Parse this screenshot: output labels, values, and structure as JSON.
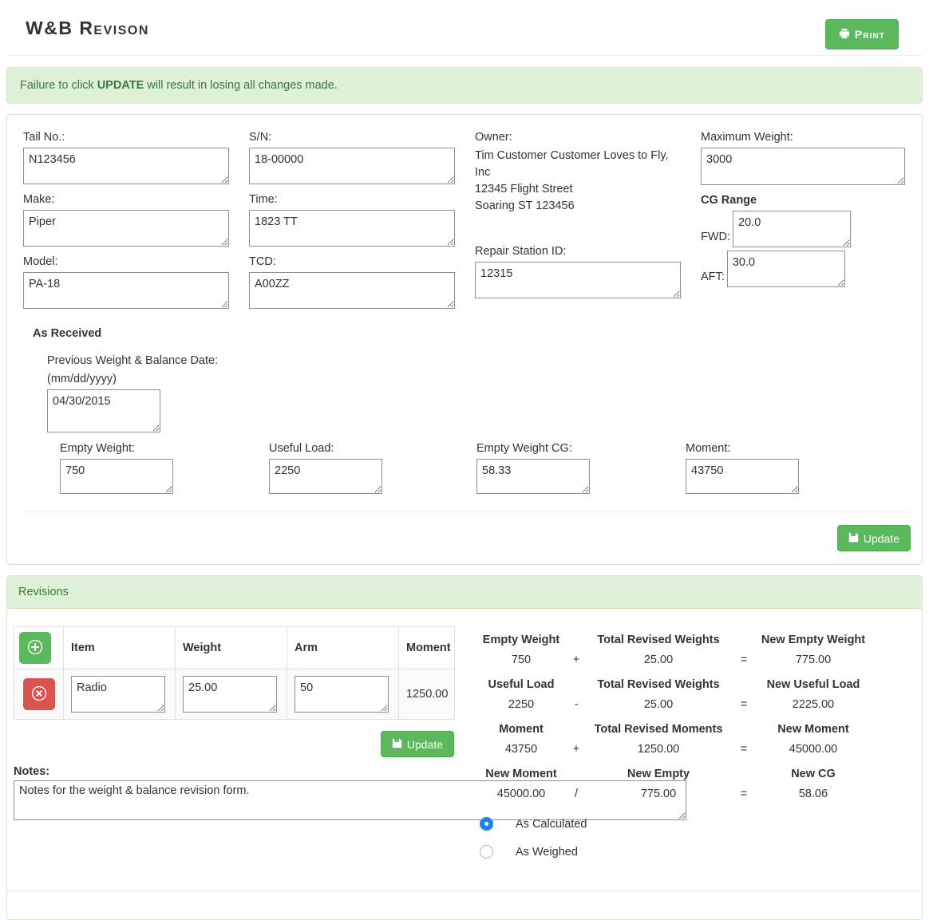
{
  "header": {
    "title": "W&B Revison",
    "print_label": "Print",
    "print_icon": "printer-icon"
  },
  "alert": {
    "prefix": "Failure to click ",
    "emphasis": "UPDATE",
    "suffix": " will result in losing all changes made."
  },
  "form": {
    "tail_no": {
      "label": "Tail No.:",
      "value": "N123456"
    },
    "make": {
      "label": "Make:",
      "value": "Piper"
    },
    "model": {
      "label": "Model:",
      "value": "PA-18"
    },
    "sn": {
      "label": "S/N:",
      "value": "18-00000"
    },
    "time": {
      "label": "Time:",
      "value": "1823 TT"
    },
    "tcd": {
      "label": "TCD:",
      "value": "A00ZZ"
    },
    "owner": {
      "label": "Owner:",
      "lines": "Tim Customer Customer Loves to Fly, Inc\n12345 Flight Street\nSoaring ST 123456"
    },
    "repair_station": {
      "label": "Repair Station ID:",
      "value": "12315"
    },
    "maximum_weight": {
      "label": "Maximum Weight:",
      "value": "3000"
    },
    "cg_range": {
      "title": "CG Range",
      "fwd": {
        "label": "FWD:",
        "value": "20.0"
      },
      "aft": {
        "label": "AFT:",
        "value": "30.0"
      }
    }
  },
  "as_received": {
    "title": "As Received",
    "prev_date": {
      "label_line1": "Previous Weight & Balance Date:",
      "label_line2": "(mm/dd/yyyy)",
      "value": "04/30/2015"
    },
    "empty_weight": {
      "label": "Empty Weight:",
      "value": "750"
    },
    "useful_load": {
      "label": "Useful Load:",
      "value": "2250"
    },
    "empty_weight_cg": {
      "label": "Empty Weight CG:",
      "value": "58.33"
    },
    "moment": {
      "label": "Moment:",
      "value": "43750"
    },
    "update_label": "Update",
    "update_icon": "save-icon"
  },
  "revisions": {
    "panel_title": "Revisions",
    "add_icon": "plus-circle-icon",
    "delete_icon": "times-circle-icon",
    "columns": [
      "Item",
      "Weight",
      "Arm",
      "Moment"
    ],
    "rows": [
      {
        "item": "Radio",
        "weight": "25.00",
        "arm": "50",
        "moment": "1250.00"
      }
    ],
    "update_label": "Update",
    "update_icon": "save-icon",
    "notes": {
      "label": "Notes:",
      "value": "Notes for the weight & balance revision form."
    },
    "options": [
      {
        "label": "As Calculated",
        "selected": true
      },
      {
        "label": "As Weighed",
        "selected": false
      }
    ],
    "calc": {
      "r1": {
        "h1": "Empty Weight",
        "h2": "Total Revised Weights",
        "h3": "New Empty Weight",
        "v1": "750",
        "op1": "+",
        "v2": "25.00",
        "op2": "=",
        "v3": "775.00"
      },
      "r2": {
        "h1": "Useful Load",
        "h2": "Total Revised Weights",
        "h3": "New Useful Load",
        "v1": "2250",
        "op1": "-",
        "v2": "25.00",
        "op2": "=",
        "v3": "2225.00"
      },
      "r3": {
        "h1": "Moment",
        "h2": "Total Revised Moments",
        "h3": "New Moment",
        "v1": "43750",
        "op1": "+",
        "v2": "1250.00",
        "op2": "=",
        "v3": "45000.00"
      },
      "r4": {
        "h1": "New Moment",
        "h2": "New Empty",
        "h3": "New CG",
        "v1": "45000.00",
        "op1": "/",
        "v2": "775.00",
        "op2": "=",
        "v3": "58.06"
      }
    }
  },
  "colors": {
    "green": "#5cb85c",
    "red": "#d9534f",
    "alert_bg": "#dff0d8",
    "alert_text": "#3c763d",
    "radio_blue": "#1a84ec"
  }
}
